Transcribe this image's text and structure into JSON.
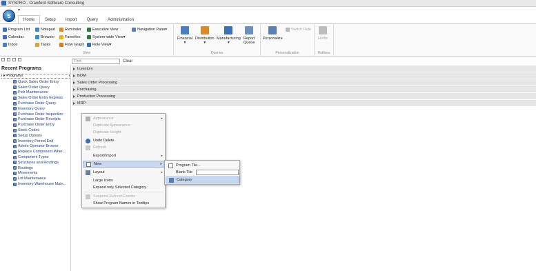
{
  "window": {
    "title": "SYSPRO - Crawford Software Consulting",
    "qat_arrow": "▾"
  },
  "orb": {
    "label": "S"
  },
  "tabs": [
    "Home",
    "Setup",
    "Import",
    "Query",
    "Administration"
  ],
  "ribbon": {
    "view": {
      "label": "View",
      "items": [
        {
          "label": "Program List",
          "icon": "program-list-icon",
          "color": "#3b6fb6"
        },
        {
          "label": "Notepad",
          "icon": "notepad-icon",
          "color": "#4a7fc1"
        },
        {
          "label": "Reminder",
          "icon": "reminder-icon",
          "color": "#d98b2b"
        },
        {
          "label": "Executive View",
          "icon": "executive-view-icon",
          "color": "#2f7a3f"
        },
        {
          "label": "Navigation Pane",
          "icon": "navigation-pane-icon",
          "color": "#5a7fb0",
          "suffix": "▾"
        },
        {
          "label": "Calendar",
          "icon": "calendar-icon",
          "color": "#3b6fb6"
        },
        {
          "label": "Browser",
          "icon": "browser-icon",
          "color": "#2e8fd0"
        },
        {
          "label": "Favorites",
          "icon": "favorites-icon",
          "color": "#e8b321"
        },
        {
          "label": "System-wide View",
          "icon": "system-wide-view-icon",
          "color": "#2f7a3f",
          "suffix": "▾"
        },
        {
          "label": "Inbox",
          "icon": "inbox-icon",
          "color": "#4a7fc1"
        },
        {
          "label": "Tasks",
          "icon": "tasks-icon",
          "color": "#d9a43a"
        },
        {
          "label": "Flow Graph",
          "icon": "flow-graph-icon",
          "color": "#d97a2b"
        },
        {
          "label": "Role View",
          "icon": "role-view-icon",
          "color": "#3b6fb6",
          "suffix": "▾"
        }
      ]
    },
    "queries": {
      "label": "Queries",
      "items": [
        {
          "label": "Financial",
          "icon": "financial-icon",
          "color": "#4a7fc1",
          "suffix": "▾"
        },
        {
          "label": "Distribution",
          "icon": "distribution-icon",
          "color": "#d98b2b",
          "suffix": "▾"
        },
        {
          "label": "Manufacturing",
          "icon": "manufacturing-icon",
          "color": "#3b6fb6",
          "suffix": "▾"
        },
        {
          "label": "Report",
          "label2": "Queue",
          "icon": "report-queue-icon",
          "color": "#6b8fbf"
        }
      ]
    },
    "personalization": {
      "label": "Personalization",
      "items": [
        {
          "label": "Personalize",
          "icon": "personalize-icon",
          "color": "#5a7fb0"
        },
        {
          "label": "Switch Role",
          "icon": "switch-role-icon",
          "color": "#b9b9b9",
          "disabled": true
        }
      ]
    },
    "hotfixes": {
      "label": "Hotfixes",
      "items": [
        {
          "label": "Hotfix",
          "icon": "hotfix-icon",
          "color": "#bdbdbd",
          "disabled": true
        }
      ]
    }
  },
  "sidebar": {
    "title": "Recent Programs",
    "root": "Programs",
    "items": [
      "Quick Sales Order Entry",
      "Sales Order Query",
      "Pick Maintenance",
      "Sales Order Entry Express",
      "Purchase Order Query",
      "Inventory Query",
      "Purchase Order Inspection",
      "Purchase Order Receipts",
      "Purchase Order Entry",
      "Stock Codes",
      "Setup Options",
      "Inventory Period End",
      "Admin Operator Browse",
      "Replace Component Wher...",
      "Component Types",
      "Structures and Routings",
      "Routings",
      "Movements",
      "Lot Maintenance",
      "Inventory Warehouse Main..."
    ]
  },
  "find": {
    "placeholder": "Find",
    "clear_label": "Clear"
  },
  "categories": [
    "Inventory",
    "BOM",
    "Sales Order Processing",
    "Purchasing",
    "Production Processing",
    "MRP"
  ],
  "context_menu": [
    {
      "label": "Appearance",
      "icon": "appearance-icon",
      "disabled": true,
      "submenu": true
    },
    {
      "label": "Duplicate Appearance",
      "disabled": true
    },
    {
      "label": "Duplicate Height",
      "disabled": true
    },
    {
      "label": "Undo Delete",
      "icon": "undo-icon"
    },
    {
      "label": "Refresh",
      "icon": "refresh-icon",
      "disabled": true
    },
    {
      "label": "Export/Import",
      "submenu": true
    },
    {
      "label": "New",
      "icon": "new-icon",
      "submenu": true,
      "highlighted": true
    },
    {
      "label": "Layout",
      "icon": "layout-icon",
      "submenu": true
    },
    {
      "label": "Large Icons"
    },
    {
      "label": "Expand only Selected Category"
    },
    {
      "label": "Suspend Refresh Events",
      "icon": "suspend-icon",
      "disabled": true
    },
    {
      "label": "Show Program Names in Tooltips"
    }
  ],
  "submenu": [
    {
      "label": "Program Tile...",
      "icon": "program-tile-icon"
    },
    {
      "label": "Blank Tile",
      "has_input": true
    },
    {
      "label": "Category",
      "icon": "category-icon",
      "highlighted": true
    }
  ]
}
